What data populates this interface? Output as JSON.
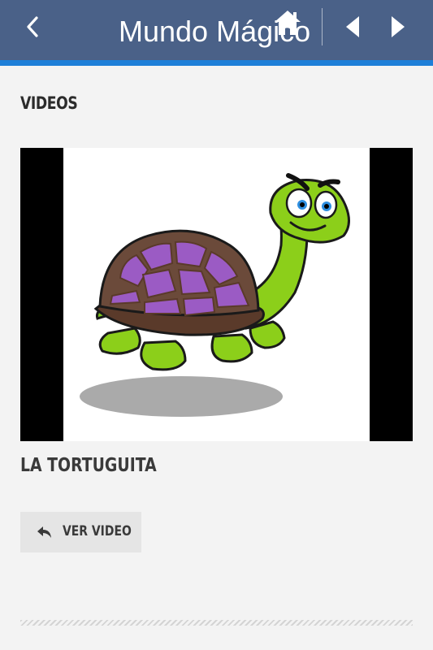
{
  "header": {
    "title": "Mundo Mágico",
    "back_icon": "chevron-left-icon",
    "home_icon": "home-icon",
    "prev_icon": "triangle-left-icon",
    "next_icon": "triangle-right-icon",
    "bar_color": "#4a6188",
    "accent_color": "#1e7fd8"
  },
  "content": {
    "section_heading": "VIDEOS",
    "video": {
      "title": "LA TORTUGUITA",
      "thumbnail": "cartoon-turtle-image"
    },
    "watch_button": {
      "label": "VER VIDEO",
      "icon": "reply-icon"
    }
  }
}
